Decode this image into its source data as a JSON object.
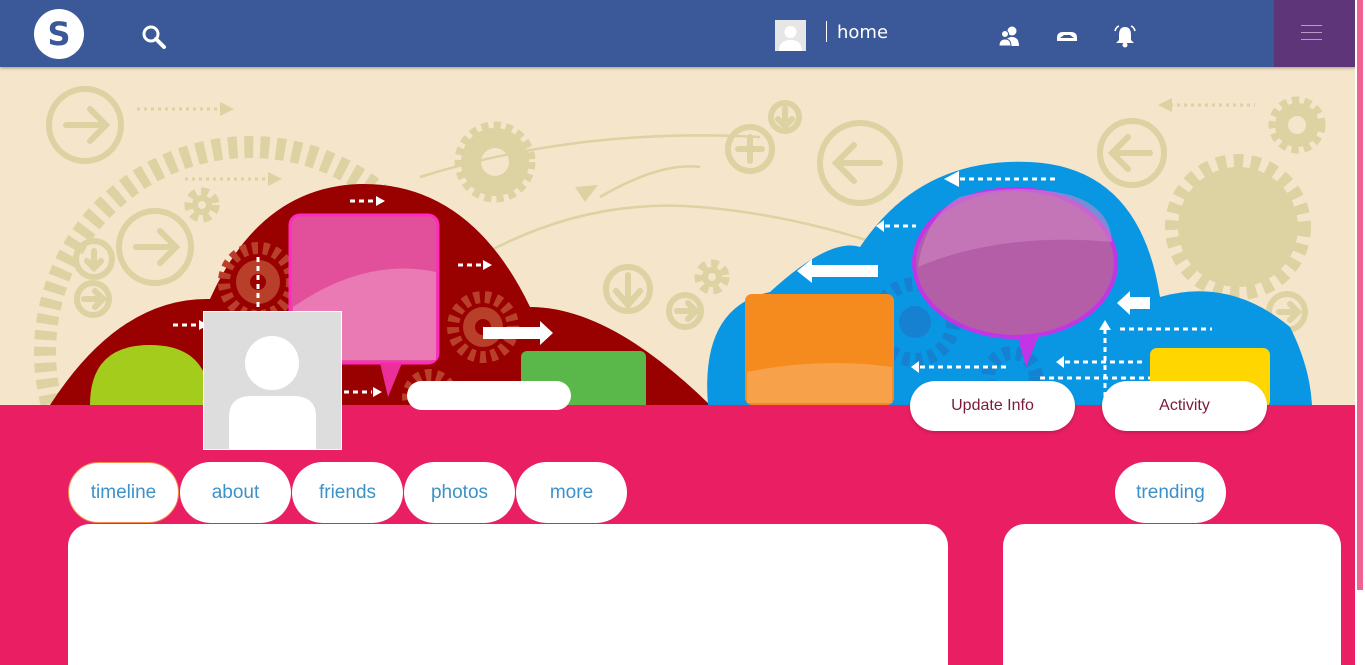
{
  "brand": {
    "logo_letter": "S",
    "color": "#3b5998"
  },
  "colors": {
    "page_background": "#e91e63",
    "menu_button": "#5e3579",
    "tab_text": "#3c91c9",
    "pill_text": "#7a1b3a"
  },
  "nav": {
    "home_label": "home",
    "icons": [
      "search-icon",
      "friends-icon",
      "messages-icon",
      "notifications-icon",
      "menu-icon"
    ]
  },
  "profile": {
    "update_info_label": "Update Info",
    "activity_label": "Activity"
  },
  "tabs": {
    "timeline": "timeline",
    "about": "about",
    "friends": "friends",
    "photos": "photos",
    "more": "more",
    "trending": "trending"
  }
}
